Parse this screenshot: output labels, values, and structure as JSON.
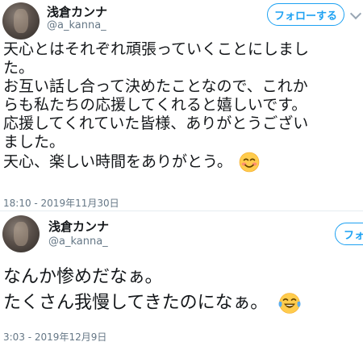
{
  "tweets": [
    {
      "display_name": "浅倉カンナ",
      "handle": "@a_kanna_",
      "follow_label": "フォローする",
      "lines": [
        "天心とはそれぞれ頑張っていくことにしまし",
        "た。",
        "お互い話し合って決めたことなので、これか",
        "らも私たちの応援してくれると嬉しいです。",
        "応援してくれていた皆様、ありがとうござい",
        "ました。",
        "天心、楽しい時間をありがとう。"
      ],
      "emoji": "smiling-face-blush",
      "timestamp": "18:10 - 2019年11月30日"
    },
    {
      "display_name": "浅倉カンナ",
      "handle": "@a_kanna_",
      "follow_label": "フォ",
      "lines": [
        "なんか惨めだなぁ。",
        "たくさん我慢してきたのになぁ。"
      ],
      "emoji": "tears-of-joy-face",
      "timestamp": "3:03 - 2019年12月9日"
    }
  ],
  "colors": {
    "accent": "#1da1f2",
    "text": "#14171a",
    "secondary": "#657786"
  }
}
